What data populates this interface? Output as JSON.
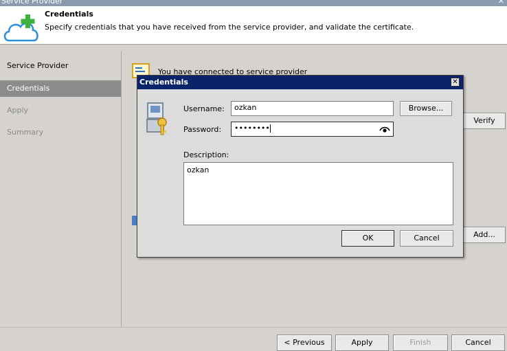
{
  "window": {
    "title": "Service Provider",
    "close_glyph": "✕"
  },
  "header": {
    "title": "Credentials",
    "subtitle": "Specify credentials that you have received from the service provider, and validate the certificate.",
    "icon": "cloud-add-icon"
  },
  "nav": {
    "items": [
      {
        "label": "Service Provider",
        "state": "normal"
      },
      {
        "label": "Credentials",
        "state": "selected"
      },
      {
        "label": "Apply",
        "state": "disabled"
      },
      {
        "label": "Summary",
        "state": "disabled"
      }
    ]
  },
  "main": {
    "info_text": "You have connected to service provider",
    "verify_label": "Verify",
    "add_label": "Add..."
  },
  "footer": {
    "previous_label": "< Previous",
    "apply_label": "Apply",
    "finish_label": "Finish",
    "cancel_label": "Cancel"
  },
  "dialog": {
    "title": "Credentials",
    "close_glyph": "✕",
    "username_label": "Username:",
    "username_value": "ozkan",
    "browse_label": "Browse...",
    "password_label": "Password:",
    "password_value": "••••••••",
    "description_label": "Description:",
    "description_value": "ozkan",
    "ok_label": "OK",
    "cancel_label": "Cancel",
    "icon": "user-key-icon",
    "reveal_icon": "eye-icon"
  },
  "colors": {
    "dialog_titlebar": "#0a246a",
    "nav_selected": "#8c8c8c",
    "plus_green": "#3db33d",
    "cloud_blue": "#2a8fd6"
  }
}
